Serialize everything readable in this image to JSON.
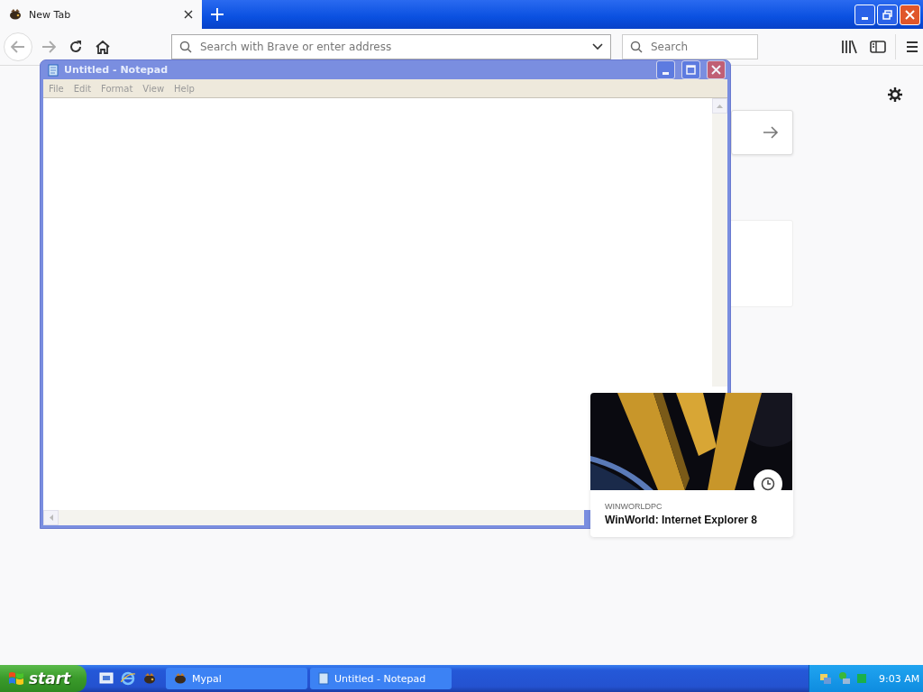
{
  "browser": {
    "tabs": [
      {
        "label": "New Tab",
        "selected": true
      }
    ],
    "address_bar": {
      "placeholder": "Search with Brave or enter address"
    },
    "search_field": {
      "placeholder": "Search"
    },
    "highlight_card": {
      "source": "WINWORLDPC",
      "title": "WinWorld: Internet Explorer 8"
    }
  },
  "notepad": {
    "title": "Untitled - Notepad",
    "menu": [
      "File",
      "Edit",
      "Format",
      "View",
      "Help"
    ]
  },
  "taskbar": {
    "start": "start",
    "tasks": [
      {
        "label": "Mypal",
        "selected": false
      },
      {
        "label": "Untitled - Notepad",
        "selected": false
      }
    ],
    "clock": "9:03 AM"
  }
}
